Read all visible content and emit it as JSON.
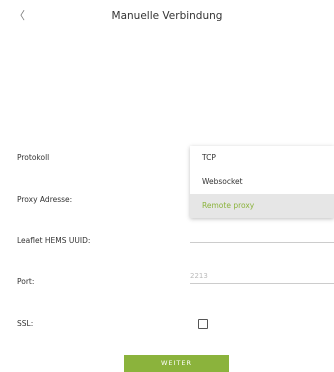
{
  "header": {
    "back_glyph": "〈",
    "back_icon": "chevron-left-icon",
    "title": "Manuelle Verbindung"
  },
  "form": {
    "protokoll": {
      "label": "Protokoll",
      "options": [
        {
          "label": "TCP",
          "selected": false
        },
        {
          "label": "Websocket",
          "selected": false
        },
        {
          "label": "Remote proxy",
          "selected": true
        }
      ]
    },
    "proxy_adresse": {
      "label": "Proxy Adresse:",
      "value": ""
    },
    "uuid": {
      "label": "Leaflet HEMS UUID:",
      "value": ""
    },
    "port": {
      "label": "Port:",
      "value": "",
      "placeholder": "2213"
    },
    "ssl": {
      "label": "SSL:",
      "checked": false
    }
  },
  "submit_label": "WEITER",
  "colors": {
    "accent": "#8bb33c",
    "selected_bg": "#e6e6e6",
    "text": "#333333",
    "underline": "#cccccc"
  }
}
